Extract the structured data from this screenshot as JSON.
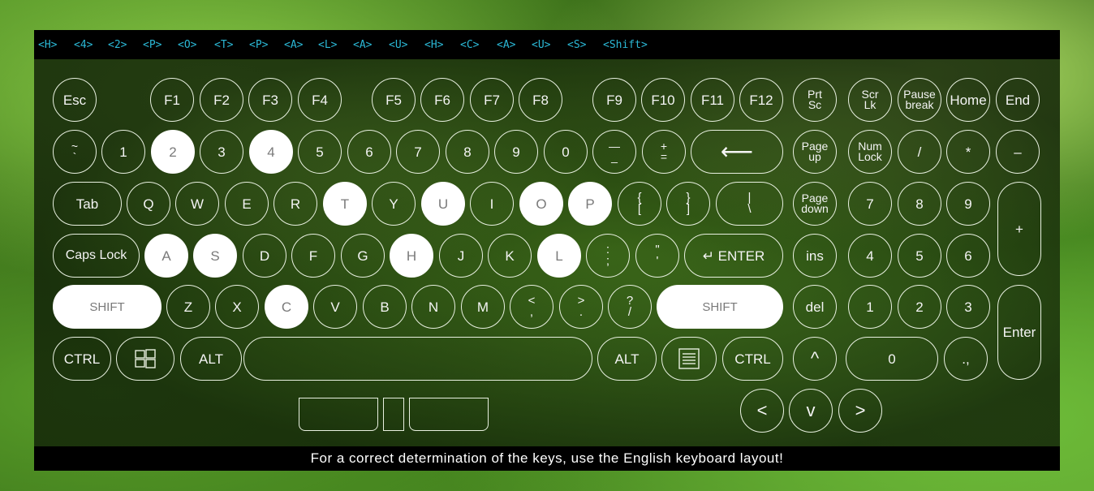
{
  "history": [
    "<H>",
    "<4>",
    "<2>",
    "<P>",
    "<O>",
    "<T>",
    "<P>",
    "<A>",
    "<L>",
    "<A>",
    "<U>",
    "<H>",
    "<C>",
    "<A>",
    "<U>",
    "<S>",
    "<Shift>"
  ],
  "footer": "For a correct determination of the keys, use the English keyboard layout!",
  "keys": {
    "esc": "Esc",
    "f1": "F1",
    "f2": "F2",
    "f3": "F3",
    "f4": "F4",
    "f5": "F5",
    "f6": "F6",
    "f7": "F7",
    "f8": "F8",
    "f9": "F9",
    "f10": "F10",
    "f11": "F11",
    "f12": "F12",
    "prtsc_1": "Prt",
    "prtsc_2": "Sc",
    "scrlk_1": "Scr",
    "scrlk_2": "Lk",
    "pause_1": "Pause",
    "pause_2": "break",
    "home": "Home",
    "end": "End",
    "tilde_1": "~",
    "tilde_2": "`",
    "d1": "1",
    "d2": "2",
    "d3": "3",
    "d4": "4",
    "d5": "5",
    "d6": "6",
    "d7": "7",
    "d8": "8",
    "d9": "9",
    "d0": "0",
    "minus_1": "—",
    "minus_2": "_",
    "plus_1": "+",
    "plus_2": "=",
    "backspace": "⟵",
    "pgup_1": "Page",
    "pgup_2": "up",
    "numlock_1": "Num",
    "numlock_2": "Lock",
    "np_div": "/",
    "np_mul": "*",
    "np_sub": "–",
    "tab": "Tab",
    "q": "Q",
    "w": "W",
    "e": "E",
    "r": "R",
    "t": "T",
    "y": "Y",
    "u": "U",
    "i": "I",
    "o": "O",
    "p": "P",
    "lbr_1": "{",
    "lbr_2": "[",
    "rbr_1": "}",
    "rbr_2": "]",
    "bsl_1": "|",
    "bsl_2": "\\",
    "pgdn_1": "Page",
    "pgdn_2": "down",
    "np7": "7",
    "np8": "8",
    "np9": "9",
    "np_add": "+",
    "caps": "Caps Lock",
    "a": "A",
    "s": "S",
    "d": "D",
    "f": "F",
    "g": "G",
    "h": "H",
    "j": "J",
    "k": "K",
    "l": "L",
    "semi_1": ":",
    "semi_2": ";",
    "quote_1": "\"",
    "quote_2": "'",
    "enter": "↵ ENTER",
    "ins": "ins",
    "np4": "4",
    "np5": "5",
    "np6": "6",
    "lshift": "SHIFT",
    "z": "Z",
    "x": "X",
    "c": "C",
    "v": "V",
    "b": "B",
    "n": "N",
    "m": "M",
    "comma_1": "<",
    "comma_2": ",",
    "period_1": ">",
    "period_2": ".",
    "slash_1": "?",
    "slash_2": "/",
    "rshift": "SHIFT",
    "del": "del",
    "np1": "1",
    "np2": "2",
    "np3": "3",
    "np_enter": "Enter",
    "lctrl": "CTRL",
    "lalt": "ALT",
    "ralt": "ALT",
    "rctrl": "CTRL",
    "up": "^",
    "np0": "0",
    "np_dot": ".,",
    "left": "<",
    "down": "v",
    "right": ">"
  },
  "pressed": [
    "2",
    "4",
    "T",
    "U",
    "O",
    "P",
    "A",
    "S",
    "H",
    "L",
    "C",
    "SHIFT"
  ],
  "colors": {
    "history_text": "#2bb8d6",
    "key_border": "#e8f0e0",
    "pressed_fill": "#ffffff"
  }
}
